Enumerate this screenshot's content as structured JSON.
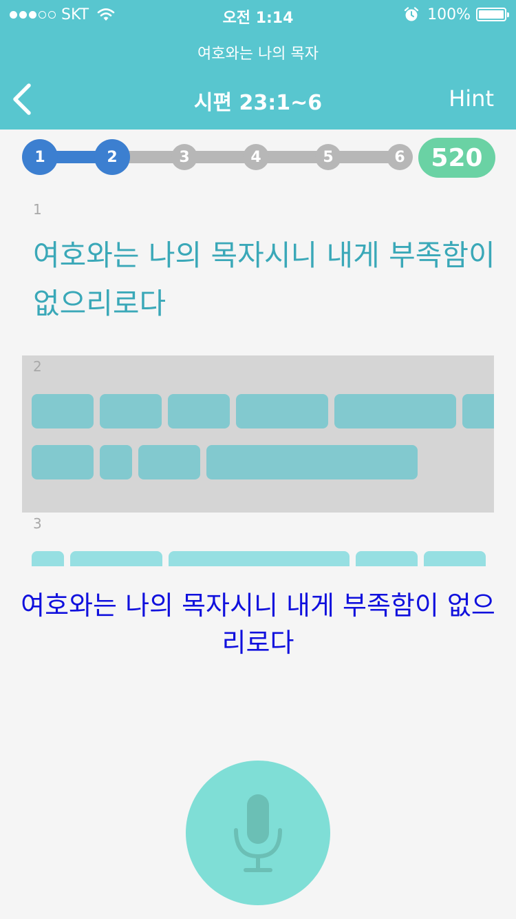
{
  "status_bar": {
    "carrier": "SKT",
    "signal_dots_filled": 3,
    "signal_dots_total": 5,
    "time": "오전 1:14",
    "battery": "100%",
    "icons": [
      "wifi-icon",
      "alarm-icon",
      "battery-icon"
    ]
  },
  "header": {
    "subtitle": "여호와는 나의 목자",
    "title": "시편 23:1~6",
    "hint_label": "Hint",
    "back_icon": "chevron-left-icon"
  },
  "progress": {
    "steps": [
      "1",
      "2",
      "3",
      "4",
      "5",
      "6"
    ],
    "completed_steps": 2,
    "score": "520"
  },
  "verses": [
    {
      "number": "1",
      "text": "여호와는 나의 목자시니 내게 부족함이 없으리로다"
    },
    {
      "number": "2"
    },
    {
      "number": "3"
    }
  ],
  "recognized_text": "여호와는 나의 목자시니 내게 부족함이 없으리로다",
  "mic": {
    "icon": "microphone-icon"
  },
  "colors": {
    "header": "#58c6cf",
    "step_active": "#3c7fd0",
    "step_inactive": "#b7b7b7",
    "score_badge": "#6ad2a4",
    "verse_text": "#3aa8b8",
    "recognized_text": "#1010dd",
    "mic_button": "#7fded6"
  }
}
